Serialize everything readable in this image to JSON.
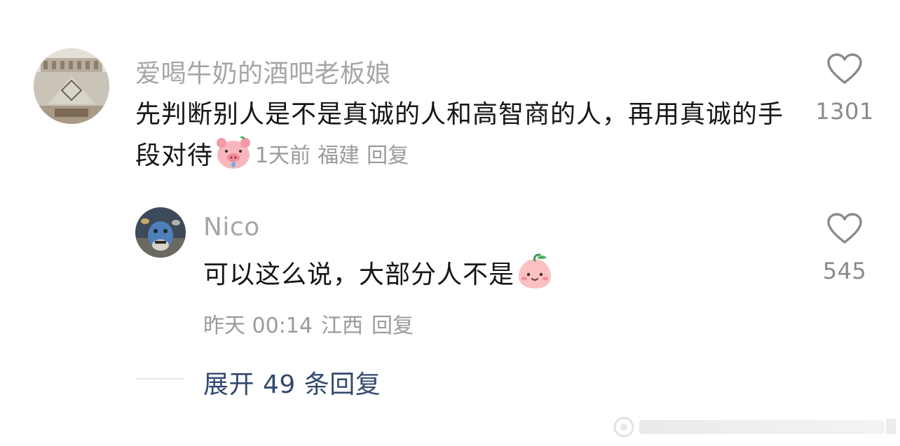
{
  "comment": {
    "username": "爱喝牛奶的酒吧老板娘",
    "text": "先判断别人是不是真诚的人和高智商的人，再用真诚的手段对待",
    "emoji": "pig-face-emoji",
    "time": "1天前",
    "location": "福建",
    "reply_label": "回复",
    "likes": "1301"
  },
  "reply": {
    "username": "Nico",
    "text": "可以这么说，大部分人不是",
    "emoji": "peach-face-emoji",
    "time": "昨天 00:14",
    "location": "江西",
    "reply_label": "回复",
    "likes": "545"
  },
  "expand": {
    "label": "展开 49 条回复"
  },
  "colors": {
    "username": "#a6a6a6",
    "text": "#161616",
    "meta": "#9b9b9b",
    "expand": "#33486e",
    "heart_stroke": "#8a8a8a"
  }
}
